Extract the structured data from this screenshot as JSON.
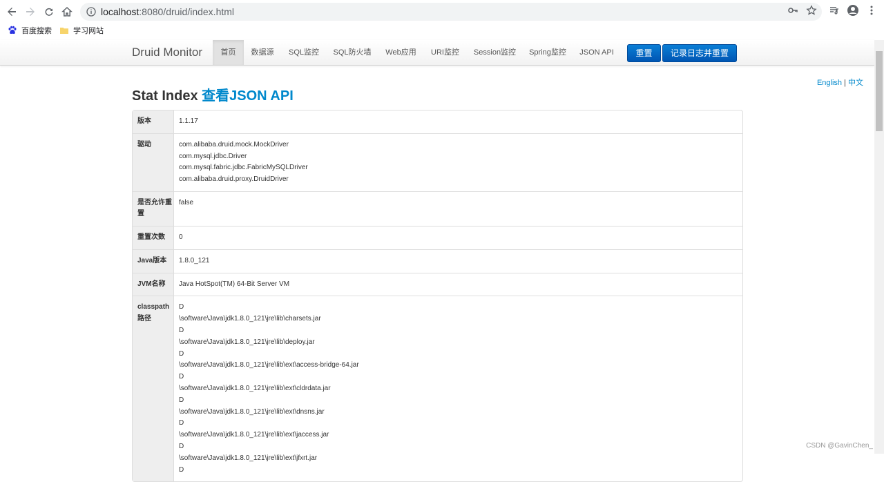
{
  "browser": {
    "url_host": "localhost",
    "url_rest": ":8080/druid/index.html",
    "bookmarks": [
      {
        "label": "百度搜索",
        "icon": "paw-icon"
      },
      {
        "label": "学习网站",
        "icon": "folder-icon"
      }
    ]
  },
  "navbar": {
    "brand": "Druid Monitor",
    "items": [
      "首页",
      "数据源",
      "SQL监控",
      "SQL防火墙",
      "Web应用",
      "URI监控",
      "Session监控",
      "Spring监控",
      "JSON API"
    ],
    "active_index": 0,
    "reset_label": "重置",
    "log_reset_label": "记录日志并重置"
  },
  "lang": {
    "english": "English",
    "sep": "|",
    "chinese": "中文"
  },
  "title": {
    "prefix": "Stat Index",
    "link": "查看JSON API"
  },
  "stats": [
    {
      "key": "版本",
      "value": [
        "1.1.17"
      ]
    },
    {
      "key": "驱动",
      "value": [
        "com.alibaba.druid.mock.MockDriver",
        "com.mysql.jdbc.Driver",
        "com.mysql.fabric.jdbc.FabricMySQLDriver",
        "com.alibaba.druid.proxy.DruidDriver"
      ]
    },
    {
      "key": "是否允许重置",
      "value": [
        "false"
      ]
    },
    {
      "key": "重置次数",
      "value": [
        "0"
      ]
    },
    {
      "key": "Java版本",
      "value": [
        "1.8.0_121"
      ]
    },
    {
      "key": "JVM名称",
      "value": [
        "Java HotSpot(TM) 64-Bit Server VM"
      ]
    },
    {
      "key": "classpath路径",
      "value": [
        "D",
        "\\software\\Java\\jdk1.8.0_121\\jre\\lib\\charsets.jar",
        "D",
        "\\software\\Java\\jdk1.8.0_121\\jre\\lib\\deploy.jar",
        "D",
        "\\software\\Java\\jdk1.8.0_121\\jre\\lib\\ext\\access-bridge-64.jar",
        "D",
        "\\software\\Java\\jdk1.8.0_121\\jre\\lib\\ext\\cldrdata.jar",
        "D",
        "\\software\\Java\\jdk1.8.0_121\\jre\\lib\\ext\\dnsns.jar",
        "D",
        "\\software\\Java\\jdk1.8.0_121\\jre\\lib\\ext\\jaccess.jar",
        "D",
        "\\software\\Java\\jdk1.8.0_121\\jre\\lib\\ext\\jfxrt.jar",
        "D"
      ]
    }
  ],
  "watermark": "CSDN @GavinChen_"
}
